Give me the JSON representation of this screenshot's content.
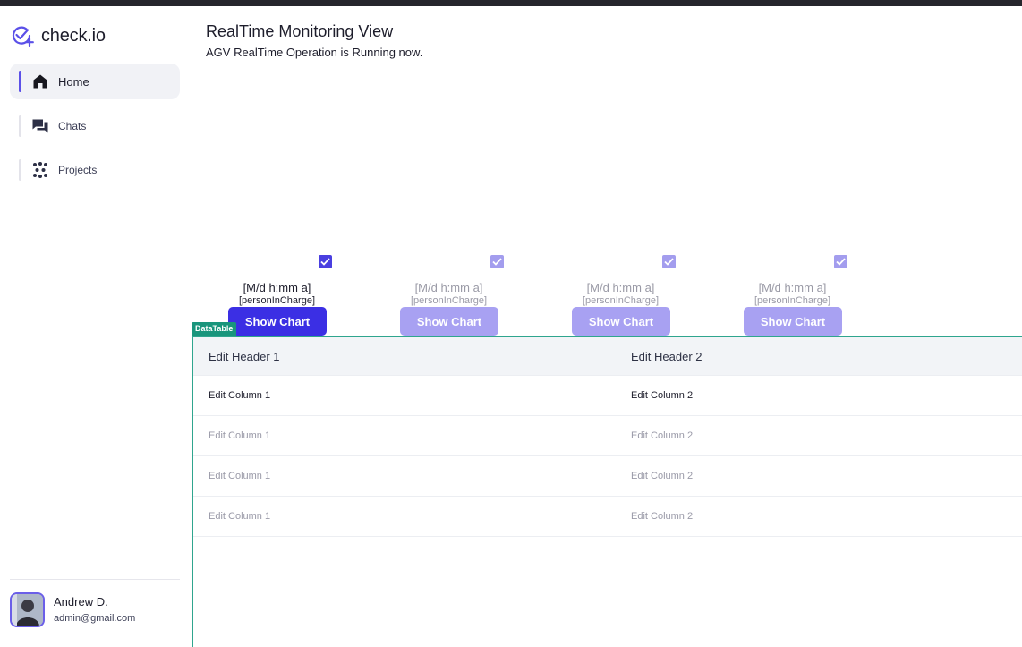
{
  "app": {
    "name": "check.io"
  },
  "sidebar": {
    "items": [
      {
        "label": "Home",
        "icon": "home-icon",
        "active": true
      },
      {
        "label": "Chats",
        "icon": "chat-icon",
        "active": false
      },
      {
        "label": "Projects",
        "icon": "projects-icon",
        "active": false
      }
    ]
  },
  "user": {
    "name": "Andrew D.",
    "email": "admin@gmail.com"
  },
  "header": {
    "title": "RealTime Monitoring View",
    "subtitle": "AGV RealTime Operation is Running now."
  },
  "cards": [
    {
      "date": "[M/d h:mm a]",
      "person": "[personInCharge]",
      "button": "Show Chart",
      "checked": true,
      "faded": false
    },
    {
      "date": "[M/d h:mm a]",
      "person": "[personInCharge]",
      "button": "Show Chart",
      "checked": true,
      "faded": true
    },
    {
      "date": "[M/d h:mm a]",
      "person": "[personInCharge]",
      "button": "Show Chart",
      "checked": true,
      "faded": true
    },
    {
      "date": "[M/d h:mm a]",
      "person": "[personInCharge]",
      "button": "Show Chart",
      "checked": true,
      "faded": true
    }
  ],
  "datatable": {
    "badge": "DataTable",
    "headers": [
      "Edit Header 1",
      "Edit Header 2"
    ],
    "rows": [
      [
        "Edit Column 1",
        "Edit Column 2"
      ],
      [
        "Edit Column 1",
        "Edit Column 2"
      ],
      [
        "Edit Column 1",
        "Edit Column 2"
      ],
      [
        "Edit Column 1",
        "Edit Column 2"
      ]
    ]
  },
  "colors": {
    "accent": "#3b2fe4",
    "accent_faded": "#a8a1f2",
    "table_border": "#2fa58e"
  }
}
